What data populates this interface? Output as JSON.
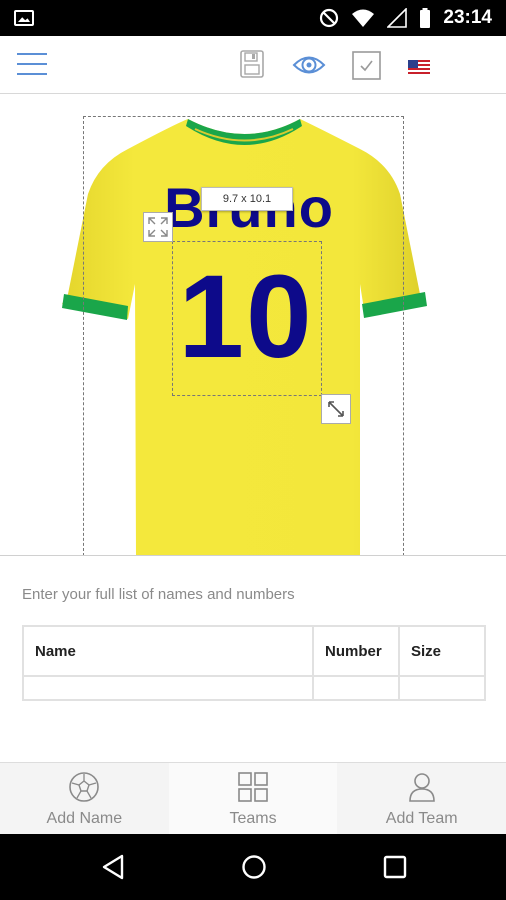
{
  "status_bar": {
    "time": "23:14"
  },
  "toolbar": {
    "menu_icon": "hamburger-menu-icon",
    "save_icon": "floppy-disk-icon",
    "preview_icon": "eye-icon",
    "confirm_icon": "checkbox-icon",
    "language_icon": "us-flag-icon",
    "accent_color": "#5b8fd6"
  },
  "design": {
    "player_name": "Bruno",
    "player_number": "10",
    "dimension_label": "9.7 x 10.1",
    "shirt_color": "#f2e63a",
    "trim_color": "#1aa64a",
    "text_color": "#0d0a8a"
  },
  "roster": {
    "instruction": "Enter your full list of names and numbers",
    "columns": [
      "Name",
      "Number",
      "Size"
    ]
  },
  "bottom_nav": {
    "items": [
      {
        "label": "Add Name",
        "icon": "soccer-ball-icon"
      },
      {
        "label": "Teams",
        "icon": "grid-icon"
      },
      {
        "label": "Add Team",
        "icon": "person-icon"
      }
    ],
    "active": "Teams"
  }
}
